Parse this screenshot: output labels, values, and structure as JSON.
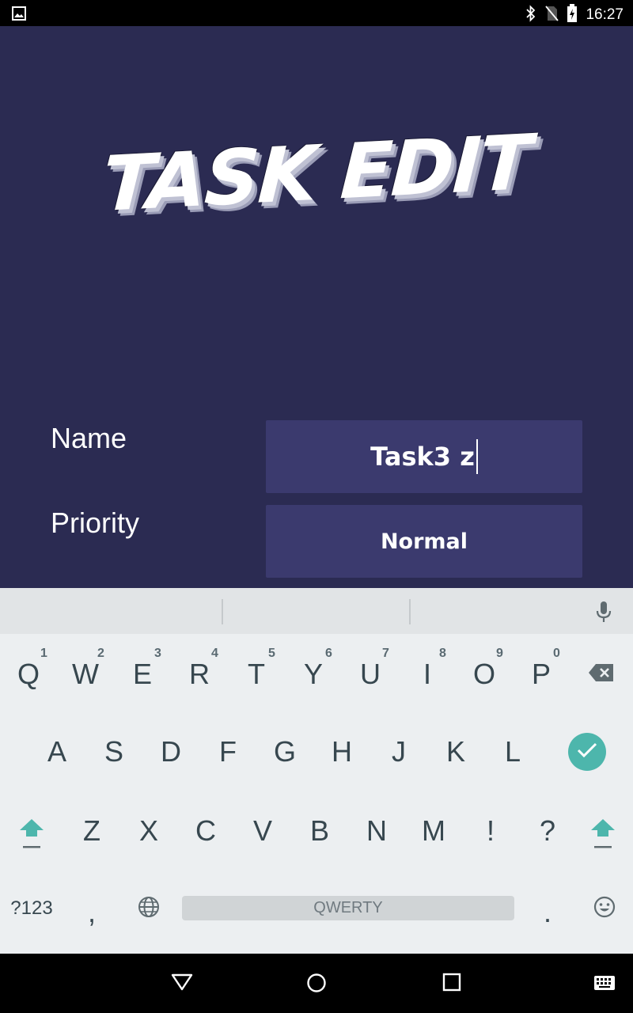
{
  "status_bar": {
    "time": "16:27",
    "icons": [
      "image-icon",
      "bluetooth-icon",
      "no-sim-icon",
      "battery-charging-icon"
    ]
  },
  "app": {
    "title": "TASK EDIT",
    "background": "#2b2b52",
    "field_background": "#3b3a6e",
    "fields": {
      "name": {
        "label": "Name",
        "value": "Task3 z"
      },
      "priority": {
        "label": "Priority",
        "value": "Normal"
      }
    }
  },
  "keyboard": {
    "row1": [
      {
        "key": "Q",
        "hint": "1"
      },
      {
        "key": "W",
        "hint": "2"
      },
      {
        "key": "E",
        "hint": "3"
      },
      {
        "key": "R",
        "hint": "4"
      },
      {
        "key": "T",
        "hint": "5"
      },
      {
        "key": "Y",
        "hint": "6"
      },
      {
        "key": "U",
        "hint": "7"
      },
      {
        "key": "I",
        "hint": "8"
      },
      {
        "key": "O",
        "hint": "9"
      },
      {
        "key": "P",
        "hint": "0"
      }
    ],
    "row2": [
      "A",
      "S",
      "D",
      "F",
      "G",
      "H",
      "J",
      "K",
      "L"
    ],
    "row3": [
      "Z",
      "X",
      "C",
      "V",
      "B",
      "N",
      "M",
      "!",
      "?"
    ],
    "symbols_label": "?123",
    "comma": ",",
    "period": ".",
    "space_label": "QWERTY",
    "accent_color": "#4db6ac"
  },
  "nav_bar": {
    "buttons": [
      "back-icon",
      "home-icon",
      "recents-icon",
      "keyboard-switch-icon"
    ]
  }
}
